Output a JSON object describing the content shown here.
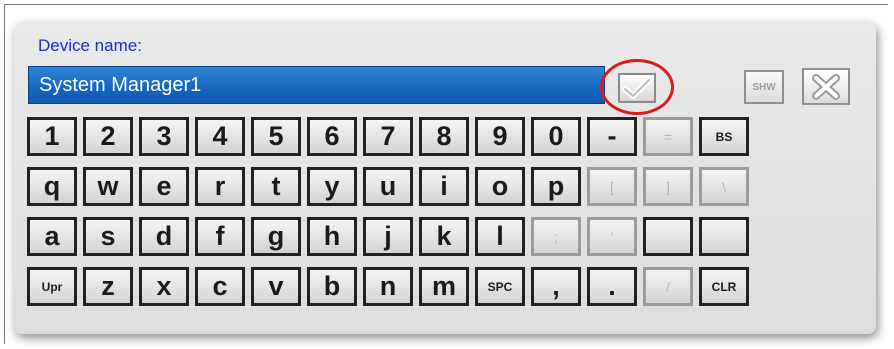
{
  "dialog": {
    "title": "Device name:",
    "input_value": "System Manager1",
    "shw_label": "SHW"
  },
  "colors": {
    "title": "#1a2bc9",
    "input_bg": "#1668c2",
    "highlight": "#d81c1c"
  },
  "icons": {
    "ok": "checkmark-icon",
    "close": "close-x-icon"
  },
  "keyboard": {
    "row1": [
      "1",
      "2",
      "3",
      "4",
      "5",
      "6",
      "7",
      "8",
      "9",
      "0",
      "-",
      "=",
      "BS"
    ],
    "row2": [
      "q",
      "w",
      "e",
      "r",
      "t",
      "y",
      "u",
      "i",
      "o",
      "p",
      "[",
      "]",
      "\\"
    ],
    "row3": [
      "a",
      "s",
      "d",
      "f",
      "g",
      "h",
      "j",
      "k",
      "l",
      ";",
      "'",
      "",
      ""
    ],
    "row4": [
      "Upr",
      "z",
      "x",
      "c",
      "v",
      "b",
      "n",
      "m",
      "SPC",
      ",",
      ".",
      "/",
      "CLR"
    ]
  }
}
